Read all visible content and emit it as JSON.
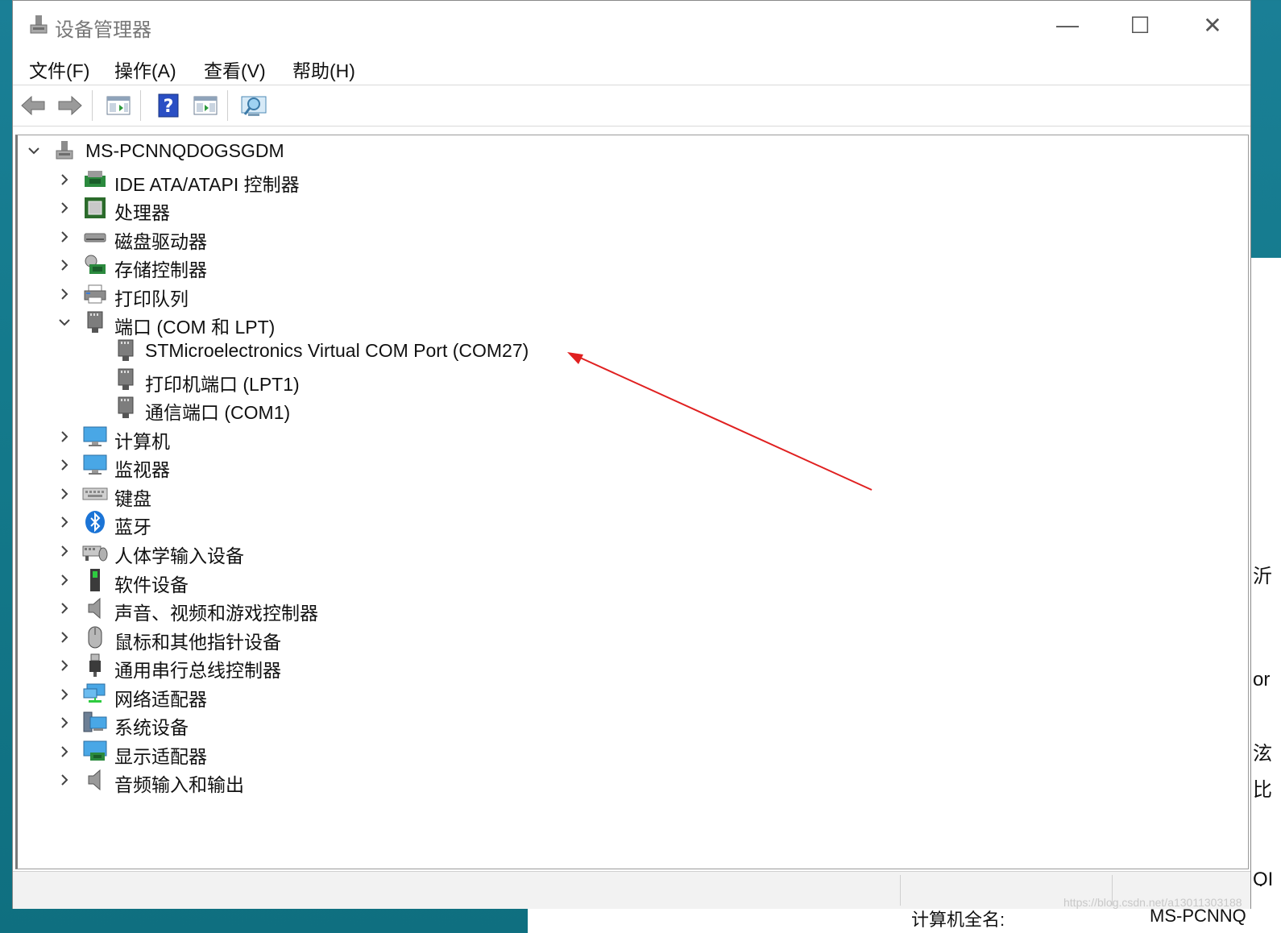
{
  "window": {
    "title": "设备管理器",
    "controls": {
      "minimize": "—",
      "maximize": "☐",
      "close": "✕"
    }
  },
  "menu": [
    "文件(F)",
    "操作(A)",
    "查看(V)",
    "帮助(H)"
  ],
  "toolbar": [
    "back-icon",
    "forward-icon",
    "properties-icon",
    "help-icon",
    "update-driver-icon",
    "scan-hardware-icon"
  ],
  "tree": {
    "root": "MS-PCNNQDOGSGDM",
    "categories": [
      {
        "label": "IDE ATA/ATAPI 控制器",
        "icon": "ide-controller-icon",
        "expanded": false
      },
      {
        "label": "处理器",
        "icon": "processor-icon",
        "expanded": false
      },
      {
        "label": "磁盘驱动器",
        "icon": "disk-drive-icon",
        "expanded": false
      },
      {
        "label": "存储控制器",
        "icon": "storage-controller-icon",
        "expanded": false
      },
      {
        "label": "打印队列",
        "icon": "printer-icon",
        "expanded": false
      },
      {
        "label": "端口 (COM 和 LPT)",
        "icon": "port-icon",
        "expanded": true,
        "children": [
          "STMicroelectronics Virtual COM Port (COM27)",
          "打印机端口 (LPT1)",
          "通信端口 (COM1)"
        ]
      },
      {
        "label": "计算机",
        "icon": "computer-icon",
        "expanded": false
      },
      {
        "label": "监视器",
        "icon": "monitor-icon",
        "expanded": false
      },
      {
        "label": "键盘",
        "icon": "keyboard-icon",
        "expanded": false
      },
      {
        "label": "蓝牙",
        "icon": "bluetooth-icon",
        "expanded": false
      },
      {
        "label": "人体学输入设备",
        "icon": "hid-icon",
        "expanded": false
      },
      {
        "label": "软件设备",
        "icon": "software-device-icon",
        "expanded": false
      },
      {
        "label": "声音、视频和游戏控制器",
        "icon": "speaker-icon",
        "expanded": false
      },
      {
        "label": "鼠标和其他指针设备",
        "icon": "mouse-icon",
        "expanded": false
      },
      {
        "label": "通用串行总线控制器",
        "icon": "usb-icon",
        "expanded": false
      },
      {
        "label": "网络适配器",
        "icon": "network-adapter-icon",
        "expanded": false
      },
      {
        "label": "系统设备",
        "icon": "system-device-icon",
        "expanded": false
      },
      {
        "label": "显示适配器",
        "icon": "display-adapter-icon",
        "expanded": false
      },
      {
        "label": "音频输入和输出",
        "icon": "audio-io-icon",
        "expanded": false
      }
    ]
  },
  "background": {
    "right_fragments": [
      "沂",
      "or",
      "泫",
      "比"
    ],
    "bottom_label": "计算机全名:",
    "bottom_value": "MS-PCNNQ",
    "side_text": "QI",
    "watermark": "https://blog.csdn.net/a13011303188"
  },
  "colors": {
    "annotation_arrow": "#e02020",
    "accent": "#1e6fd0"
  }
}
